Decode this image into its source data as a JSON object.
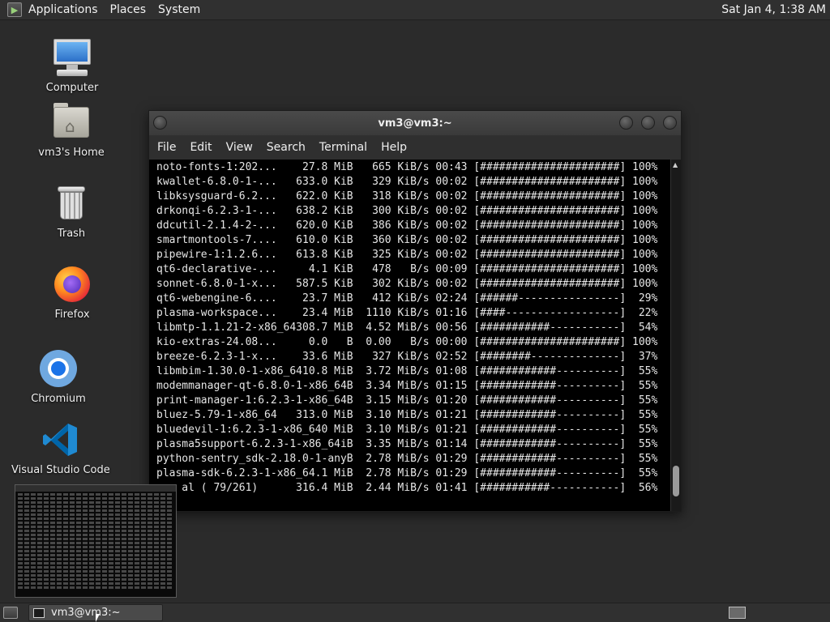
{
  "top_panel": {
    "menus": [
      "Applications",
      "Places",
      "System"
    ],
    "clock": "Sat Jan  4,  1:38 AM"
  },
  "desktop": {
    "icons": [
      {
        "label": "Computer",
        "icon": "computer-icon"
      },
      {
        "label": "vm3's Home",
        "icon": "home-folder-icon"
      },
      {
        "label": "Trash",
        "icon": "trash-icon"
      },
      {
        "label": "Firefox",
        "icon": "firefox-icon"
      },
      {
        "label": "Chromium",
        "icon": "chromium-icon"
      },
      {
        "label": "Visual Studio Code",
        "icon": "vscode-icon"
      }
    ]
  },
  "terminal": {
    "title": "vm3@vm3:~",
    "menu": [
      "File",
      "Edit",
      "View",
      "Search",
      "Terminal",
      "Help"
    ],
    "lines": [
      "noto-fonts-1:202...    27.8 MiB   665 KiB/s 00:43 [######################] 100%",
      "kwallet-6.8.0-1-...   633.0 KiB   329 KiB/s 00:02 [######################] 100%",
      "libksysguard-6.2...   622.0 KiB   318 KiB/s 00:02 [######################] 100%",
      "drkonqi-6.2.3-1-...   638.2 KiB   300 KiB/s 00:02 [######################] 100%",
      "ddcutil-2.1.4-2-...   620.0 KiB   386 KiB/s 00:02 [######################] 100%",
      "smartmontools-7....   610.0 KiB   360 KiB/s 00:02 [######################] 100%",
      "pipewire-1:1.2.6...   613.8 KiB   325 KiB/s 00:02 [######################] 100%",
      "qt6-declarative-...     4.1 KiB   478   B/s 00:09 [######################] 100%",
      "sonnet-6.8.0-1-x...   587.5 KiB   302 KiB/s 00:02 [######################] 100%",
      "qt6-webengine-6....    23.7 MiB   412 KiB/s 02:24 [######----------------]  29%",
      "plasma-workspace...    23.4 MiB  1110 KiB/s 01:16 [####------------------]  22%",
      "libmtp-1.1.21-2-x86_64308.7 MiB  4.52 MiB/s 00:56 [###########-----------]  54%",
      "kio-extras-24.08...     0.0   B  0.00   B/s 00:00 [######################] 100%",
      "breeze-6.2.3-1-x...    33.6 MiB   327 KiB/s 02:52 [########--------------]  37%",
      "libmbim-1.30.0-1-x86_6410.8 MiB  3.72 MiB/s 01:08 [############----------]  55%",
      "modemmanager-qt-6.8.0-1-x86_64B  3.34 MiB/s 01:15 [############----------]  55%",
      "print-manager-1:6.2.3-1-x86_64B  3.15 MiB/s 01:20 [############----------]  55%",
      "bluez-5.79-1-x86_64   313.0 MiB  3.10 MiB/s 01:21 [############----------]  55%",
      "bluedevil-1:6.2.3-1-x86_640 MiB  3.10 MiB/s 01:21 [############----------]  55%",
      "plasma5support-6.2.3-1-x86_64iB  3.35 MiB/s 01:14 [############----------]  55%",
      "python-sentry_sdk-2.18.0-1-anyB  2.78 MiB/s 01:29 [############----------]  55%",
      "plasma-sdk-6.2.3-1-x86_64.1 MiB  2.78 MiB/s 01:29 [############----------]  55%",
      "    al ( 79/261)      316.4 MiB  2.44 MiB/s 01:41 [###########-----------]  56%"
    ]
  },
  "taskbar": {
    "task_label": "vm3@vm3:~"
  }
}
